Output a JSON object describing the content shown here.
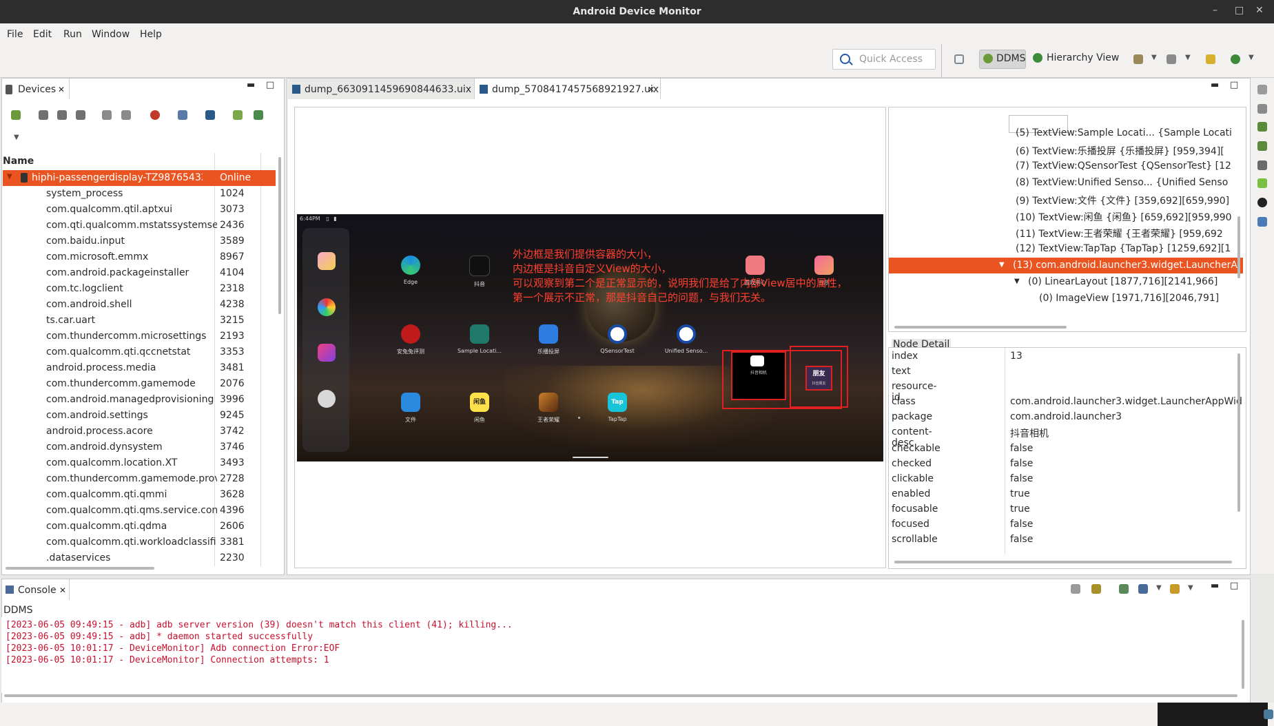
{
  "window": {
    "title": "Android Device Monitor"
  },
  "menu": [
    "File",
    "Edit",
    "Run",
    "Window",
    "Help"
  ],
  "toolbar": {
    "quick_access_placeholder": "Quick Access",
    "perspectives": [
      "DDMS",
      "Hierarchy View"
    ]
  },
  "devices": {
    "tab_label": "Devices",
    "column_name": "Name",
    "device": {
      "name": "hiphi-passengerdisplay-TZ98765432",
      "status": "Online"
    },
    "processes": [
      {
        "name": "system_process",
        "pid": "1024"
      },
      {
        "name": "com.qualcomm.qtil.aptxui",
        "pid": "3073"
      },
      {
        "name": "com.qti.qualcomm.mstatssystemse",
        "pid": "2436"
      },
      {
        "name": "com.baidu.input",
        "pid": "3589"
      },
      {
        "name": "com.microsoft.emmx",
        "pid": "8967"
      },
      {
        "name": "com.android.packageinstaller",
        "pid": "4104"
      },
      {
        "name": "com.tc.logclient",
        "pid": "2318"
      },
      {
        "name": "com.android.shell",
        "pid": "4238"
      },
      {
        "name": "ts.car.uart",
        "pid": "3215"
      },
      {
        "name": "com.thundercomm.microsettings",
        "pid": "2193"
      },
      {
        "name": "com.qualcomm.qti.qccnetstat",
        "pid": "3353"
      },
      {
        "name": "android.process.media",
        "pid": "3481"
      },
      {
        "name": "com.thundercomm.gamemode",
        "pid": "2076"
      },
      {
        "name": "com.android.managedprovisioning",
        "pid": "3996"
      },
      {
        "name": "com.android.settings",
        "pid": "9245"
      },
      {
        "name": "android.process.acore",
        "pid": "3742"
      },
      {
        "name": "com.android.dynsystem",
        "pid": "3746"
      },
      {
        "name": "com.qualcomm.location.XT",
        "pid": "3493"
      },
      {
        "name": "com.thundercomm.gamemode.prov",
        "pid": "2728"
      },
      {
        "name": "com.qualcomm.qti.qmmi",
        "pid": "3628"
      },
      {
        "name": "com.qualcomm.qti.qms.service.conr",
        "pid": "4396"
      },
      {
        "name": "com.qualcomm.qti.qdma",
        "pid": "2606"
      },
      {
        "name": "com.qualcomm.qti.workloadclassifi",
        "pid": "3381"
      },
      {
        "name": ".dataservices",
        "pid": "2230"
      }
    ]
  },
  "editor_tabs": [
    "dump_6630911459690844633.uix",
    "dump_5708417457568921927.uix"
  ],
  "screenshot": {
    "status_time": "6:44PM",
    "overlay_lines": [
      "外边框是我们提供容器的大小，",
      "内边框是抖音自定义View的大小，",
      "可以观察到第二个是正常显示的，说明我们是给了内部View居中的属性，",
      "第一个展示不正常，那是抖音自己的问题，与我们无关。"
    ],
    "apps_row1": [
      "Edge",
      "抖音",
      "游戏中心",
      "音乐"
    ],
    "apps_row2": [
      "安兔兔评测",
      "Sample Locati...",
      "乐播投屏",
      "QSensorTest",
      "Unified Senso..."
    ],
    "apps_row3": [
      "文件",
      "闲鱼",
      "王者荣耀",
      "TapTap"
    ],
    "widget1_label": "抖音相机",
    "widget2_text": "朋友",
    "widget2_label": "抖音朋友",
    "xianyu_icon_text": "闲鱼",
    "taptap_icon_text": "Tap"
  },
  "hierarchy": {
    "rows": [
      {
        "text": "(5) TextView:Sample Locati... {Sample Locati",
        "indent": 1
      },
      {
        "text": "(6) TextView:乐播投屏 {乐播投屏} [959,394][",
        "indent": 1
      },
      {
        "text": "(7) TextView:QSensorTest {QSensorTest} [12",
        "indent": 1
      },
      {
        "text": "(8) TextView:Unified Senso... {Unified Senso",
        "indent": 1
      },
      {
        "text": "(9) TextView:文件 {文件} [359,692][659,990]",
        "indent": 1
      },
      {
        "text": "(10) TextView:闲鱼 {闲鱼} [659,692][959,990",
        "indent": 1
      },
      {
        "text": "(11) TextView:王者荣耀 {王者荣耀} [959,692",
        "indent": 1
      },
      {
        "text": "(12) TextView:TapTap {TapTap} [1259,692][1",
        "indent": 1
      },
      {
        "text": "(13) com.android.launcher3.widget.LauncherA",
        "indent": 1,
        "selected": true
      },
      {
        "text": "(0) LinearLayout [1877,716][2141,966]",
        "indent": 2
      },
      {
        "text": "(0) ImageView [1971,716][2046,791]",
        "indent": 3
      }
    ]
  },
  "node_detail": {
    "title": "Node Detail",
    "rows": [
      {
        "key": "index",
        "value": "13"
      },
      {
        "key": "text",
        "value": ""
      },
      {
        "key": "resource-id",
        "value": ""
      },
      {
        "key": "class",
        "value": "com.android.launcher3.widget.LauncherAppWid"
      },
      {
        "key": "package",
        "value": "com.android.launcher3"
      },
      {
        "key": "content-desc",
        "value": "抖音相机"
      },
      {
        "key": "checkable",
        "value": "false"
      },
      {
        "key": "checked",
        "value": "false"
      },
      {
        "key": "clickable",
        "value": "false"
      },
      {
        "key": "enabled",
        "value": "true"
      },
      {
        "key": "focusable",
        "value": "true"
      },
      {
        "key": "focused",
        "value": "false"
      },
      {
        "key": "scrollable",
        "value": "false"
      }
    ]
  },
  "console": {
    "tab_label": "Console",
    "source": "DDMS",
    "lines": [
      "[2023-06-05 09:49:15 - adb] adb server version (39) doesn't match this client (41); killing...",
      "[2023-06-05 09:49:15 - adb] * daemon started successfully",
      "[2023-06-05 10:01:17 - DeviceMonitor] Adb connection Error:EOF",
      "[2023-06-05 10:01:17 - DeviceMonitor] Connection attempts: 1"
    ]
  },
  "colors": {
    "accent": "#e95420",
    "titlebar": "#2d2d2d",
    "console_text": "#c8102e",
    "overlay_red": "#ff4030"
  }
}
